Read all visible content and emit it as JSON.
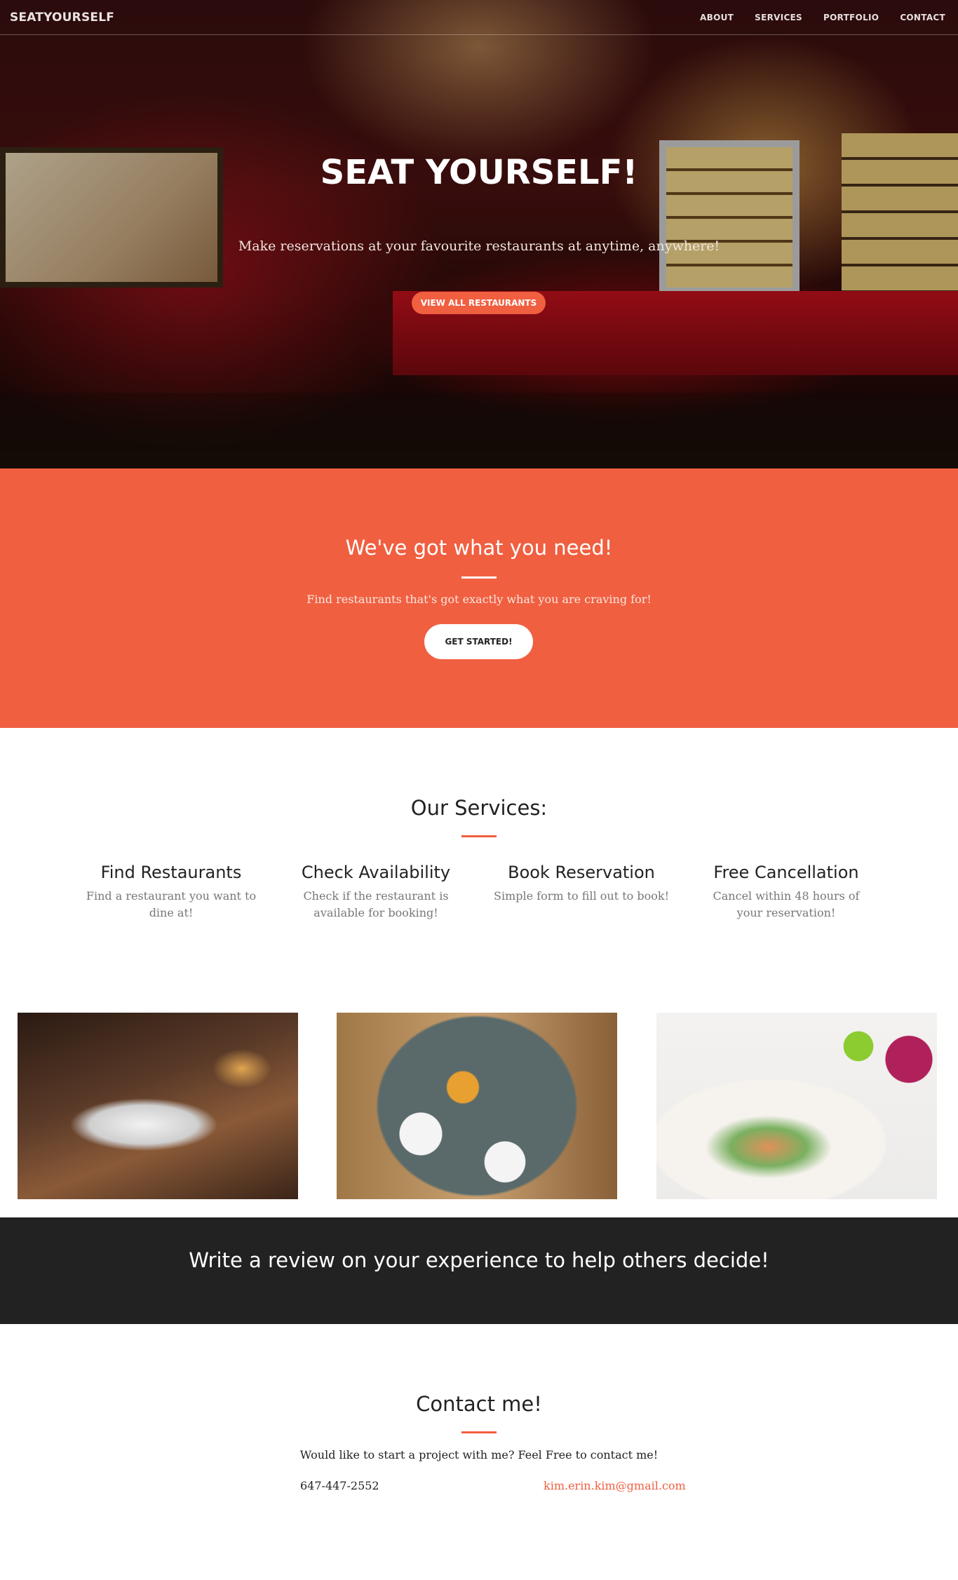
{
  "nav": {
    "brand": "SEATYOURSELF",
    "links": [
      "ABOUT",
      "SERVICES",
      "PORTFOLIO",
      "CONTACT"
    ]
  },
  "hero": {
    "title": "SEAT YOURSELF!",
    "subtitle": "Make reservations at your favourite restaurants at anytime, anywhere!",
    "button": "VIEW ALL RESTAURANTS"
  },
  "need": {
    "title": "We've got what you need!",
    "text": "Find restaurants that's got exactly what you are craving for!",
    "button": "GET STARTED!"
  },
  "services": {
    "title": "Our Services:",
    "items": [
      {
        "title": "Find Restaurants",
        "text": "Find a restaurant you want to dine at!"
      },
      {
        "title": "Check Availability",
        "text": "Check if the restaurant is available for booking!"
      },
      {
        "title": "Book Reservation",
        "text": "Simple form to fill out to book!"
      },
      {
        "title": "Free Cancellation",
        "text": "Cancel within 48 hours of your reservation!"
      }
    ]
  },
  "review": {
    "text": "Write a review on your experience to help others decide!"
  },
  "contact": {
    "title": "Contact me!",
    "text": "Would like to start a project with me? Feel Free to contact me!",
    "phone": "647-447-2552",
    "email": "kim.erin.kim@gmail.com"
  },
  "colors": {
    "accent": "#f05f40",
    "dark": "#222222"
  }
}
